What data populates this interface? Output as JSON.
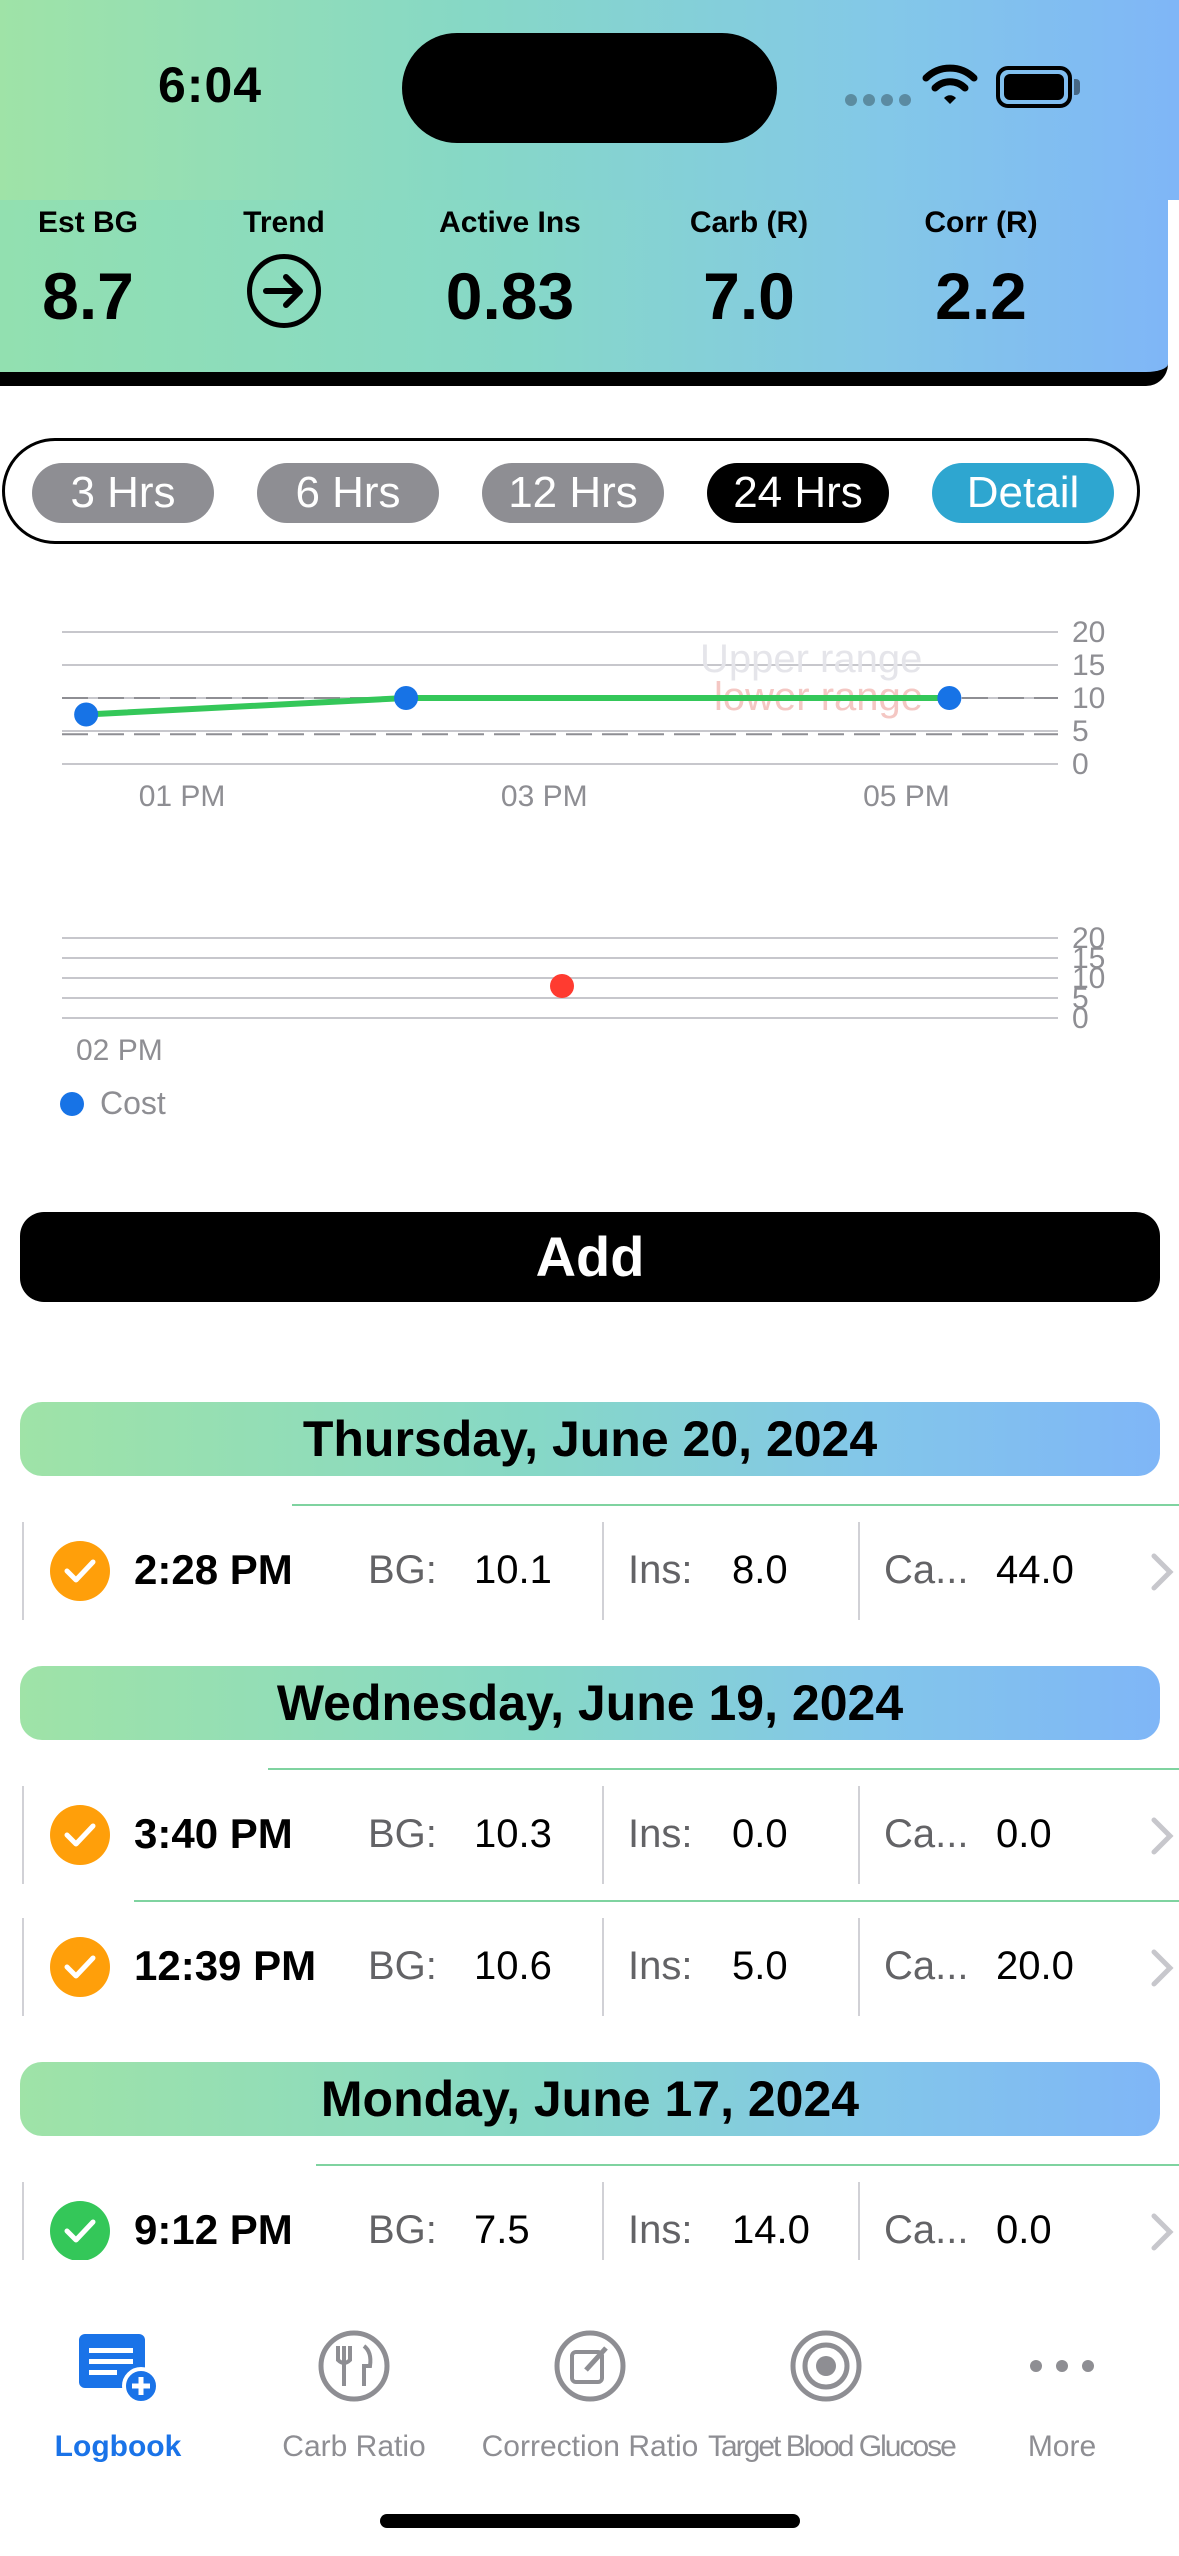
{
  "status_bar": {
    "time": "6:04"
  },
  "metrics": [
    {
      "label": "Est BG",
      "value": "8.7"
    },
    {
      "label": "Trend",
      "icon": "arrow-right-circle-icon"
    },
    {
      "label": "Active Ins",
      "value": "0.83"
    },
    {
      "label": "Carb (R)",
      "value": "7.0"
    },
    {
      "label": "Corr (R)",
      "value": "2.2"
    }
  ],
  "range_options": [
    "3 Hrs",
    "6 Hrs",
    "12 Hrs",
    "24 Hrs",
    "Detail"
  ],
  "range_selected": "24 Hrs",
  "chart_data": [
    {
      "type": "line",
      "series": [
        {
          "x": [
            "12:28 PM",
            "02:14 PM",
            "05:14 PM"
          ],
          "values": [
            7.5,
            10.0,
            10.0
          ],
          "color": "#1773e6"
        }
      ],
      "reference_lines": [
        {
          "label": "Upper range",
          "value": 10
        },
        {
          "label": "lower range",
          "value": 4.5
        }
      ],
      "xticks": [
        "01 PM",
        "03 PM",
        "05 PM"
      ],
      "yticks": [
        0,
        5,
        10,
        15,
        20
      ],
      "ylim": [
        0,
        20
      ],
      "grid": true
    },
    {
      "type": "scatter",
      "series": [
        {
          "x": [
            "02:30 PM"
          ],
          "values": [
            8
          ],
          "color": "#ff3b30"
        }
      ],
      "xticks": [
        "02 PM"
      ],
      "yticks": [
        0,
        5,
        10,
        15,
        20
      ],
      "ylim": [
        0,
        20
      ],
      "legend": [
        "Cost"
      ],
      "legend_color": "#1773e6",
      "legend_position": "bottom-left",
      "grid": true
    }
  ],
  "add_label": "Add",
  "logbook": [
    {
      "date": "Thursday, June 20, 2024",
      "entries": [
        {
          "time": "2:28 PM",
          "bg_label": "BG:",
          "bg": "10.1",
          "ins_label": "Ins:",
          "ins": "8.0",
          "carb_label": "Ca...",
          "carb": "44.0",
          "status": "orange"
        }
      ]
    },
    {
      "date": "Wednesday, June 19, 2024",
      "entries": [
        {
          "time": "3:40 PM",
          "bg_label": "BG:",
          "bg": "10.3",
          "ins_label": "Ins:",
          "ins": "0.0",
          "carb_label": "Ca...",
          "carb": "0.0",
          "status": "orange"
        },
        {
          "time": "12:39 PM",
          "bg_label": "BG:",
          "bg": "10.6",
          "ins_label": "Ins:",
          "ins": "5.0",
          "carb_label": "Ca...",
          "carb": "20.0",
          "status": "orange"
        }
      ]
    },
    {
      "date": "Monday, June 17, 2024",
      "entries": [
        {
          "time": "9:12 PM",
          "bg_label": "BG:",
          "bg": "7.5",
          "ins_label": "Ins:",
          "ins": "14.0",
          "carb_label": "Ca...",
          "carb": "0.0",
          "status": "green"
        }
      ]
    }
  ],
  "tabs": [
    {
      "label": "Logbook",
      "icon": "logbook-icon",
      "active": true
    },
    {
      "label": "Carb Ratio",
      "icon": "fork-knife-icon",
      "active": false
    },
    {
      "label": "Correction Ratio",
      "icon": "edit-icon",
      "active": false
    },
    {
      "label": "Target Blood Glucose",
      "icon": "target-icon",
      "active": false
    },
    {
      "label": "More",
      "icon": "more-icon",
      "active": false
    }
  ]
}
